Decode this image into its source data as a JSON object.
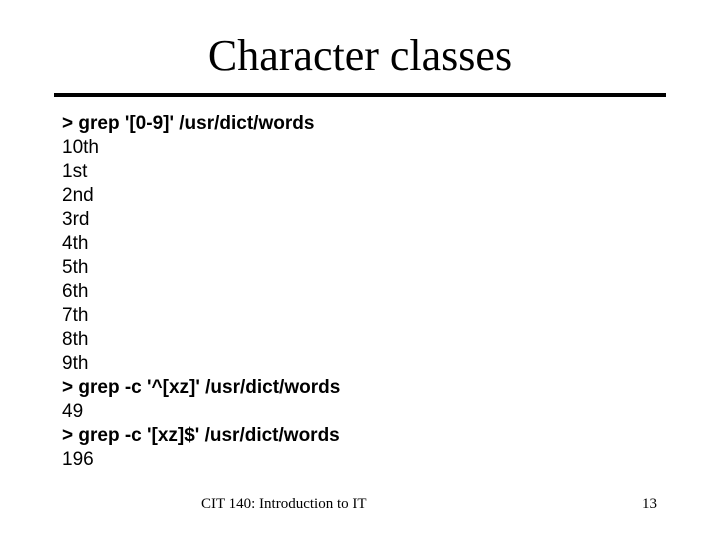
{
  "slide": {
    "title": "Character classes",
    "lines": [
      {
        "text": "> grep '[0-9]' /usr/dict/words",
        "kind": "command"
      },
      {
        "text": "10th",
        "kind": "output"
      },
      {
        "text": "1st",
        "kind": "output"
      },
      {
        "text": "2nd",
        "kind": "output"
      },
      {
        "text": "3rd",
        "kind": "output"
      },
      {
        "text": "4th",
        "kind": "output"
      },
      {
        "text": "5th",
        "kind": "output"
      },
      {
        "text": "6th",
        "kind": "output"
      },
      {
        "text": "7th",
        "kind": "output"
      },
      {
        "text": "8th",
        "kind": "output"
      },
      {
        "text": "9th",
        "kind": "output"
      },
      {
        "text": "> grep -c '^[xz]' /usr/dict/words",
        "kind": "command"
      },
      {
        "text": "49",
        "kind": "output"
      },
      {
        "text": "> grep -c '[xz]$' /usr/dict/words",
        "kind": "command"
      },
      {
        "text": "196",
        "kind": "output"
      }
    ],
    "footer": {
      "course": "CIT 140: Introduction to IT",
      "page_number": "13"
    }
  }
}
